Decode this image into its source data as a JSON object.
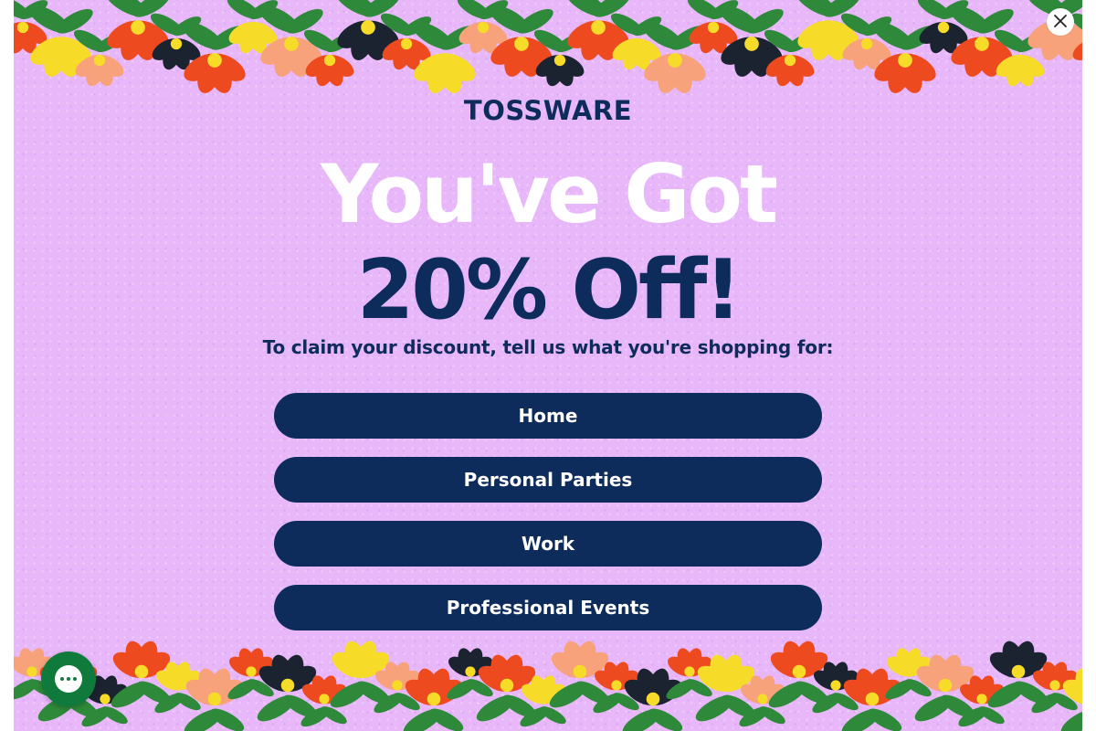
{
  "brand": {
    "logo_text": "TOSSWARE"
  },
  "headline": {
    "line1": "You've Got",
    "line2": "20% Off!"
  },
  "subtitle": "To claim your discount, tell us what you're shopping for:",
  "options": [
    {
      "label": "Home"
    },
    {
      "label": "Personal Parties"
    },
    {
      "label": "Work"
    },
    {
      "label": "Professional Events"
    }
  ],
  "icons": {
    "close": "close-icon",
    "chat": "chat-icon"
  },
  "colors": {
    "background": "#e7b7f9",
    "navy": "#0d2c5c",
    "white": "#ffffff",
    "chat_green": "#0f7a3c",
    "flower_red": "#ee4a1f",
    "flower_yellow": "#f6dc29",
    "flower_peach": "#f7a27a",
    "leaf_dark": "#1b2230",
    "leaf_green": "#2e8a3a"
  }
}
